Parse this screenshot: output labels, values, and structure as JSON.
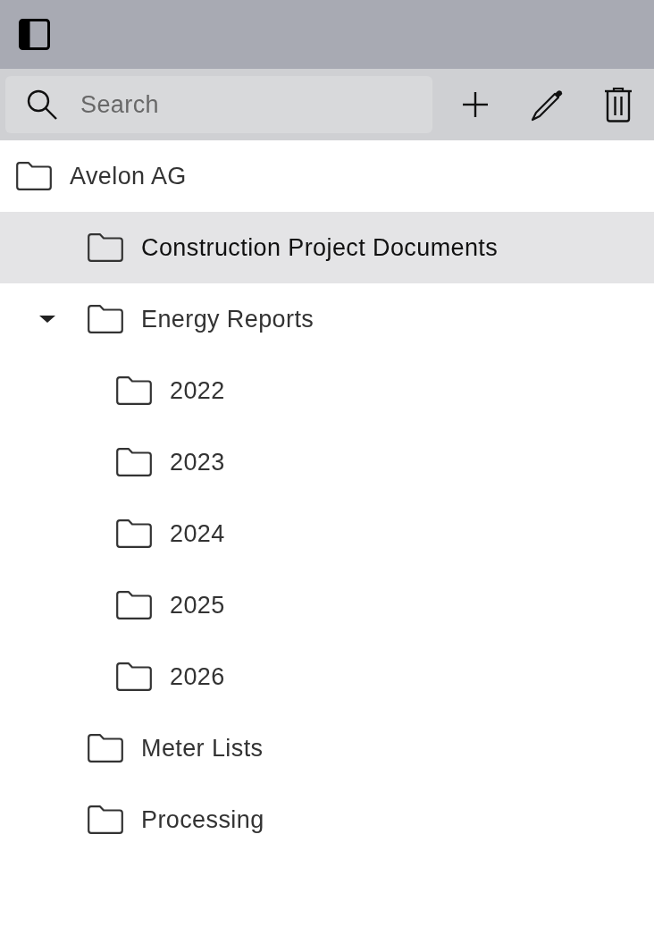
{
  "search": {
    "placeholder": "Search"
  },
  "tree": [
    {
      "label": "Avelon AG",
      "selected": false,
      "children": [
        {
          "label": "Construction Project Documents",
          "selected": true
        },
        {
          "label": "Energy Reports",
          "selected": false,
          "expanded": true,
          "children": [
            {
              "label": "2022",
              "selected": false
            },
            {
              "label": "2023",
              "selected": false
            },
            {
              "label": "2024",
              "selected": false
            },
            {
              "label": "2025",
              "selected": false
            },
            {
              "label": "2026",
              "selected": false
            }
          ]
        },
        {
          "label": "Meter Lists",
          "selected": false
        },
        {
          "label": "Processing",
          "selected": false
        }
      ]
    }
  ]
}
